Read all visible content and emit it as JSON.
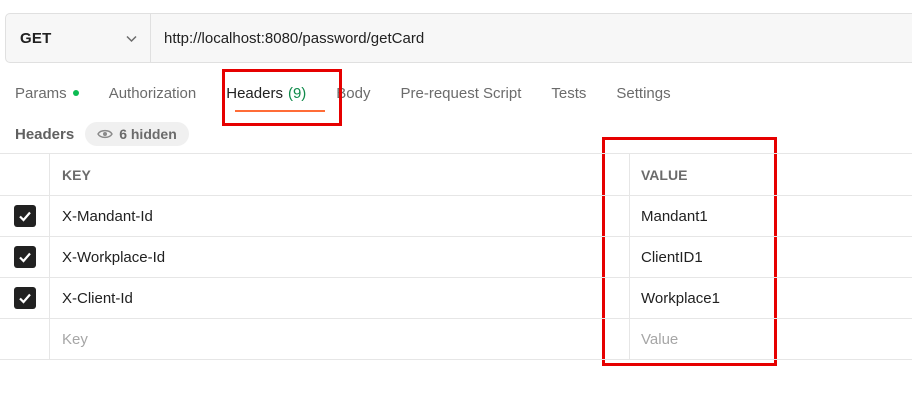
{
  "request": {
    "method": "GET",
    "url": "http://localhost:8080/password/getCard"
  },
  "tabs": [
    {
      "label": "Params",
      "has_dot": true
    },
    {
      "label": "Authorization"
    },
    {
      "label": "Headers",
      "count": "(9)",
      "active": true
    },
    {
      "label": "Body"
    },
    {
      "label": "Pre-request Script"
    },
    {
      "label": "Tests"
    },
    {
      "label": "Settings"
    }
  ],
  "headers_section": {
    "title": "Headers",
    "hidden_label": "6 hidden"
  },
  "table": {
    "columns": [
      "KEY",
      "VALUE"
    ],
    "rows": [
      {
        "checked": true,
        "key": "X-Mandant-Id",
        "value": "Mandant1"
      },
      {
        "checked": true,
        "key": "X-Workplace-Id",
        "value": "ClientID1"
      },
      {
        "checked": true,
        "key": "X-Client-Id",
        "value": "Workplace1"
      }
    ],
    "placeholder_key": "Key",
    "placeholder_value": "Value"
  },
  "colors": {
    "accent": "#ff6c37",
    "highlight": "#e60000",
    "count": "#0f8a4a",
    "dot": "#0cbb52"
  },
  "icons": [
    "chevron-down-icon",
    "eye-icon",
    "check-icon"
  ]
}
